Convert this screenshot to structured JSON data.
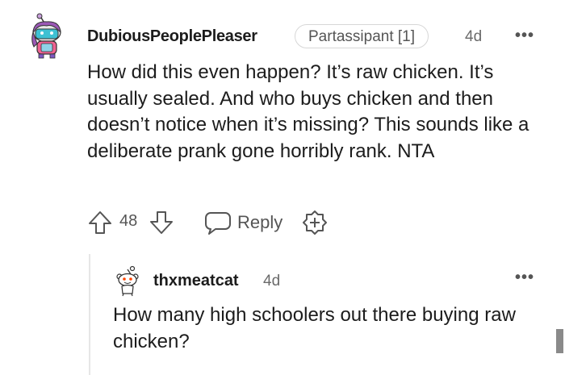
{
  "comment": {
    "username": "DubiousPeoplePleaser",
    "flair": "Partassipant [1]",
    "age": "4d",
    "more_label": "•••",
    "body": "How did this even happen? It’s raw chicken. It’s usually sealed. And who buys chicken and then doesn’t notice when it’s missing? This sounds like a deliberate prank gone horribly rank. NTA",
    "vote_count": "48",
    "reply_label": "Reply"
  },
  "reply": {
    "username": "thxmeatcat",
    "age": "4d",
    "more_label": "•••",
    "body": "How many high schoolers out there buying raw chicken?"
  }
}
